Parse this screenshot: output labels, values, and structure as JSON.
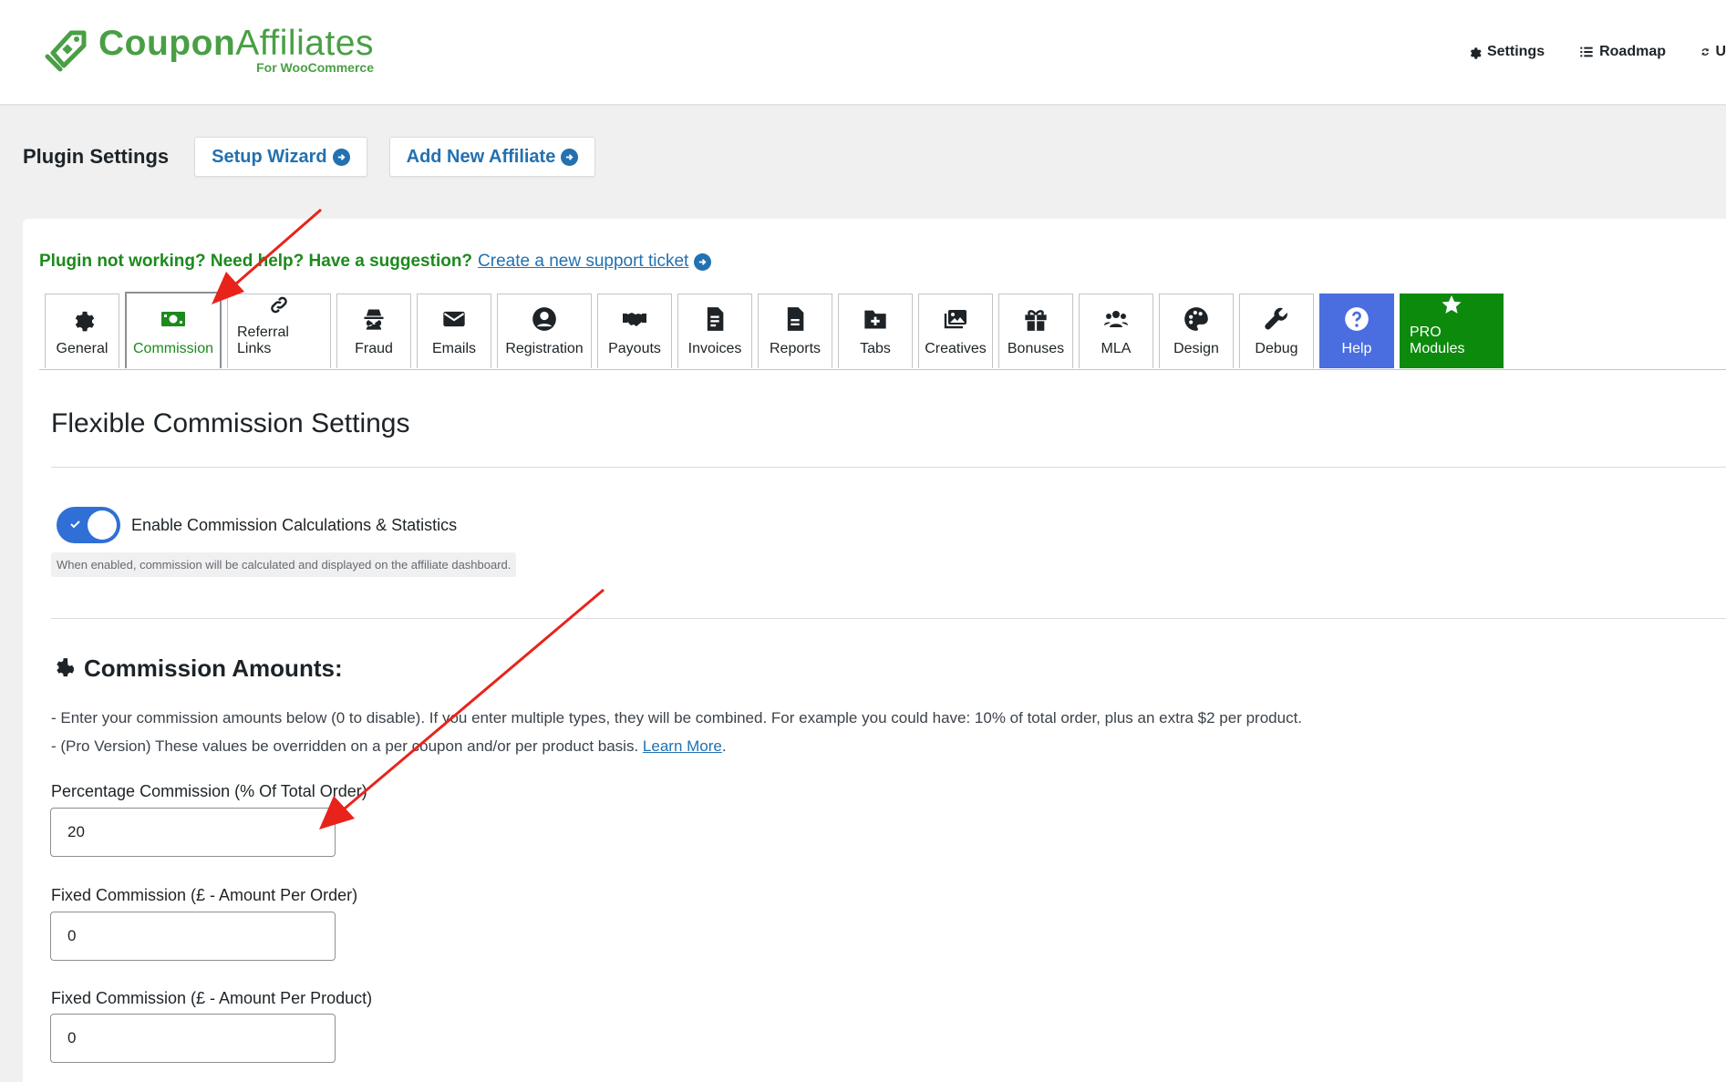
{
  "header": {
    "logo_title_bold": "Coupon",
    "logo_title_light": "Affiliates",
    "logo_sub": "For WooCommerce",
    "nav": [
      {
        "label": "Settings",
        "icon": "gear-icon"
      },
      {
        "label": "Roadmap",
        "icon": "list-icon"
      },
      {
        "label": "U",
        "icon": "refresh-icon"
      }
    ]
  },
  "settings_bar": {
    "title": "Plugin Settings",
    "setup_wizard": "Setup Wizard",
    "add_affiliate": "Add New Affiliate"
  },
  "support": {
    "text": "Plugin not working? Need help? Have a suggestion?",
    "link": "Create a new support ticket"
  },
  "tabs": [
    {
      "label": "General",
      "icon": "gear-icon"
    },
    {
      "label": "Commission",
      "icon": "money-icon"
    },
    {
      "label": "Referral Links",
      "icon": "link-icon"
    },
    {
      "label": "Fraud",
      "icon": "spy-icon"
    },
    {
      "label": "Emails",
      "icon": "envelope-icon"
    },
    {
      "label": "Registration",
      "icon": "user-circle-icon"
    },
    {
      "label": "Payouts",
      "icon": "handshake-icon"
    },
    {
      "label": "Invoices",
      "icon": "invoice-icon"
    },
    {
      "label": "Reports",
      "icon": "file-icon"
    },
    {
      "label": "Tabs",
      "icon": "folder-plus-icon"
    },
    {
      "label": "Creatives",
      "icon": "images-icon"
    },
    {
      "label": "Bonuses",
      "icon": "gift-icon"
    },
    {
      "label": "MLA",
      "icon": "users-icon"
    },
    {
      "label": "Design",
      "icon": "palette-icon"
    },
    {
      "label": "Debug",
      "icon": "wrench-icon"
    },
    {
      "label": "Help",
      "icon": "question-icon"
    },
    {
      "label": "PRO Modules",
      "icon": "star-icon"
    }
  ],
  "active_tab": "Commission",
  "section": {
    "title": "Flexible Commission Settings",
    "toggle_label": "Enable Commission Calculations & Statistics",
    "toggle_on": true,
    "hint": "When enabled, commission will be calculated and displayed on the affiliate dashboard."
  },
  "amounts": {
    "title": "Commission Amounts:",
    "line1": "- Enter your commission amounts below (0 to disable). If you enter multiple types, they will be combined. For example you could have: 10% of total order, plus an extra $2 per product.",
    "line2": "- (Pro Version) These values be overridden on a per coupon and/or per product basis.",
    "learn_more": "Learn More",
    "line2_end": "."
  },
  "fields": [
    {
      "label": "Percentage Commission (% Of Total Order)",
      "value": "20"
    },
    {
      "label": "Fixed Commission (£ - Amount Per Order)",
      "value": "0"
    },
    {
      "label": "Fixed Commission (£ - Amount Per Product)",
      "value": "0"
    }
  ],
  "colors": {
    "brand_green": "#4a9f45",
    "link_blue": "#2271b1",
    "help_tab": "#4a6ee0",
    "pro_tab": "#0c8a0c",
    "arrow_red": "#e8231b"
  }
}
